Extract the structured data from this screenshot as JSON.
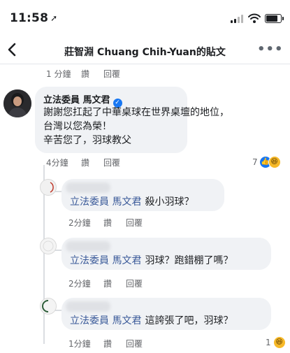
{
  "status_bar": {
    "time": "11:58",
    "arrow": "➚"
  },
  "header": {
    "title": "莊智淵  Chuang Chih-Yuan的貼文",
    "back_icon": "chevron-left-icon",
    "more": "•••"
  },
  "top_actions": {
    "time": "1 分鐘",
    "like": "讚",
    "reply": "回覆"
  },
  "main_comment": {
    "author": "立法委員 馬文君",
    "verified_mark": "✓",
    "lines": [
      "謝謝您扛起了中華桌球在世界桌壇的地位，",
      "台灣以您為榮！",
      "辛苦您了，羽球教父"
    ],
    "time": "4分鐘",
    "like": "讚",
    "reply": "回覆",
    "reaction_count": "7",
    "reaction_icons": [
      "like-icon",
      "haha-icon"
    ]
  },
  "replies": [
    {
      "tag": "立法委員 馬文君",
      "text": "殺小羽球？",
      "time": "2分鐘",
      "like": "讚",
      "reply": "回覆"
    },
    {
      "tag": "立法委員 馬文君",
      "text": "羽球？跑錯棚了嗎？",
      "time": "2分鐘",
      "like": "讚",
      "reply": "回覆"
    },
    {
      "tag": "立法委員 馬文君",
      "text": "這誇張了吧，羽球？",
      "time": "1分鐘",
      "like": "讚",
      "reply": "回覆",
      "reaction_count": "1"
    }
  ],
  "colors": {
    "link_blue": "#385898",
    "fb_blue": "#1877f2",
    "bubble": "#f0f2f5",
    "meta_gray": "#65676b"
  }
}
